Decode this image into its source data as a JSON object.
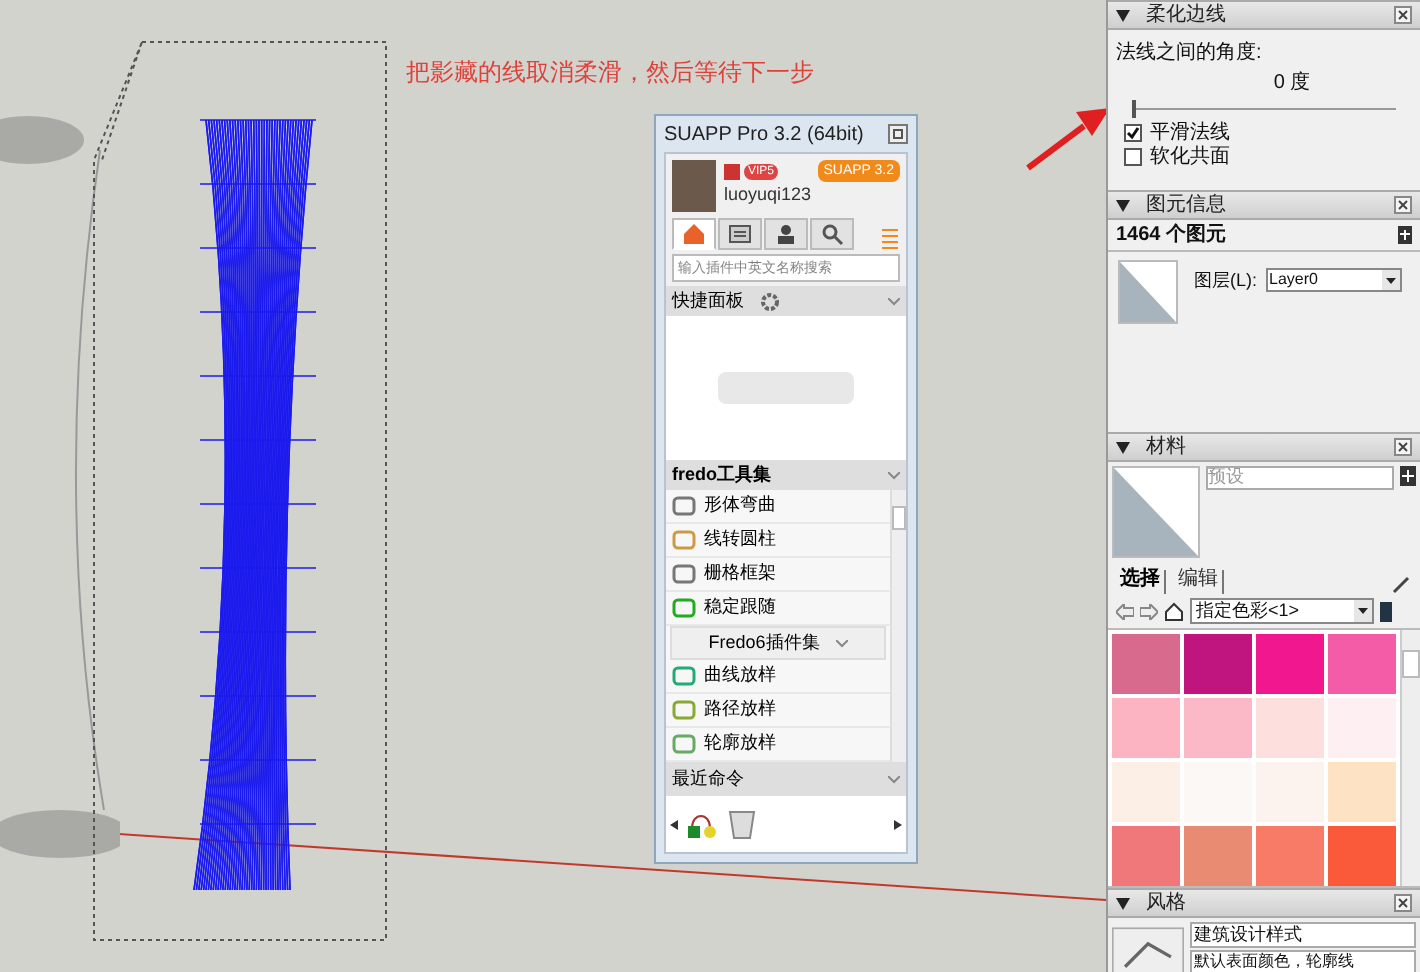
{
  "canvas": {
    "annotation": "把影藏的线取消柔滑，然后等待下一步"
  },
  "suapp": {
    "title": "SUAPP Pro 3.2 (64bit)",
    "badge": "SUAPP 3.2",
    "vip": "VIP5",
    "username": "luoyuqi123",
    "tabs": [
      {
        "kind": "home",
        "selected": true
      },
      {
        "kind": "card",
        "selected": false
      },
      {
        "kind": "user",
        "selected": false
      },
      {
        "kind": "search",
        "selected": false
      }
    ],
    "search": {
      "placeholder": "输入插件中英文名称搜索"
    },
    "quick_panel": {
      "title": "快捷面板"
    },
    "toolset": {
      "title": "fredo工具集",
      "items": [
        {
          "kind": "item",
          "label": "形体弯曲"
        },
        {
          "kind": "item",
          "label": "线转圆柱"
        },
        {
          "kind": "item",
          "label": "栅格框架"
        },
        {
          "kind": "item",
          "label": "稳定跟随"
        },
        {
          "kind": "group",
          "label": "Fredo6插件集"
        },
        {
          "kind": "item",
          "label": "曲线放样"
        },
        {
          "kind": "item",
          "label": "路径放样"
        },
        {
          "kind": "item",
          "label": "轮廓放样"
        }
      ]
    },
    "recent": {
      "title": "最近命令"
    }
  },
  "soften": {
    "title": "柔化边线",
    "angle_label": "法线之间的角度:",
    "angle_value": "0 度",
    "level": 0,
    "options": [
      {
        "label": "平滑法线",
        "checked": true
      },
      {
        "label": "软化共面",
        "checked": false
      }
    ]
  },
  "entity_info": {
    "title": "图元信息",
    "count": "1464 个图元",
    "layer_label": "图层(L):",
    "layer_value": "Layer0"
  },
  "materials": {
    "title": "材料",
    "name_value": "预设",
    "tabs": [
      {
        "label": "选择",
        "selected": true
      },
      {
        "label": "编辑",
        "selected": false
      }
    ],
    "collection": "指定色彩<1>",
    "swatches": [
      {
        "color": "#d86a8e"
      },
      {
        "color": "#c0157e"
      },
      {
        "color": "#f0178f"
      },
      {
        "color": "#f45ca8"
      },
      {
        "color": "#fcb3c2"
      },
      {
        "color": "#fbb8c6"
      },
      {
        "color": "#fde0de"
      },
      {
        "color": "#fdeff2"
      },
      {
        "color": "#fcf0e6"
      },
      {
        "color": "#fbf8f6"
      },
      {
        "color": "#fdf3ee"
      },
      {
        "color": "#fde2c4"
      },
      {
        "color": "#f0787a"
      },
      {
        "color": "#e98b72"
      },
      {
        "color": "#f87b67"
      },
      {
        "color": "#fb5a3a"
      }
    ]
  },
  "styles": {
    "title": "风格",
    "name_value": "建筑设计样式",
    "description": "默认表面颜色，轮廓线"
  }
}
